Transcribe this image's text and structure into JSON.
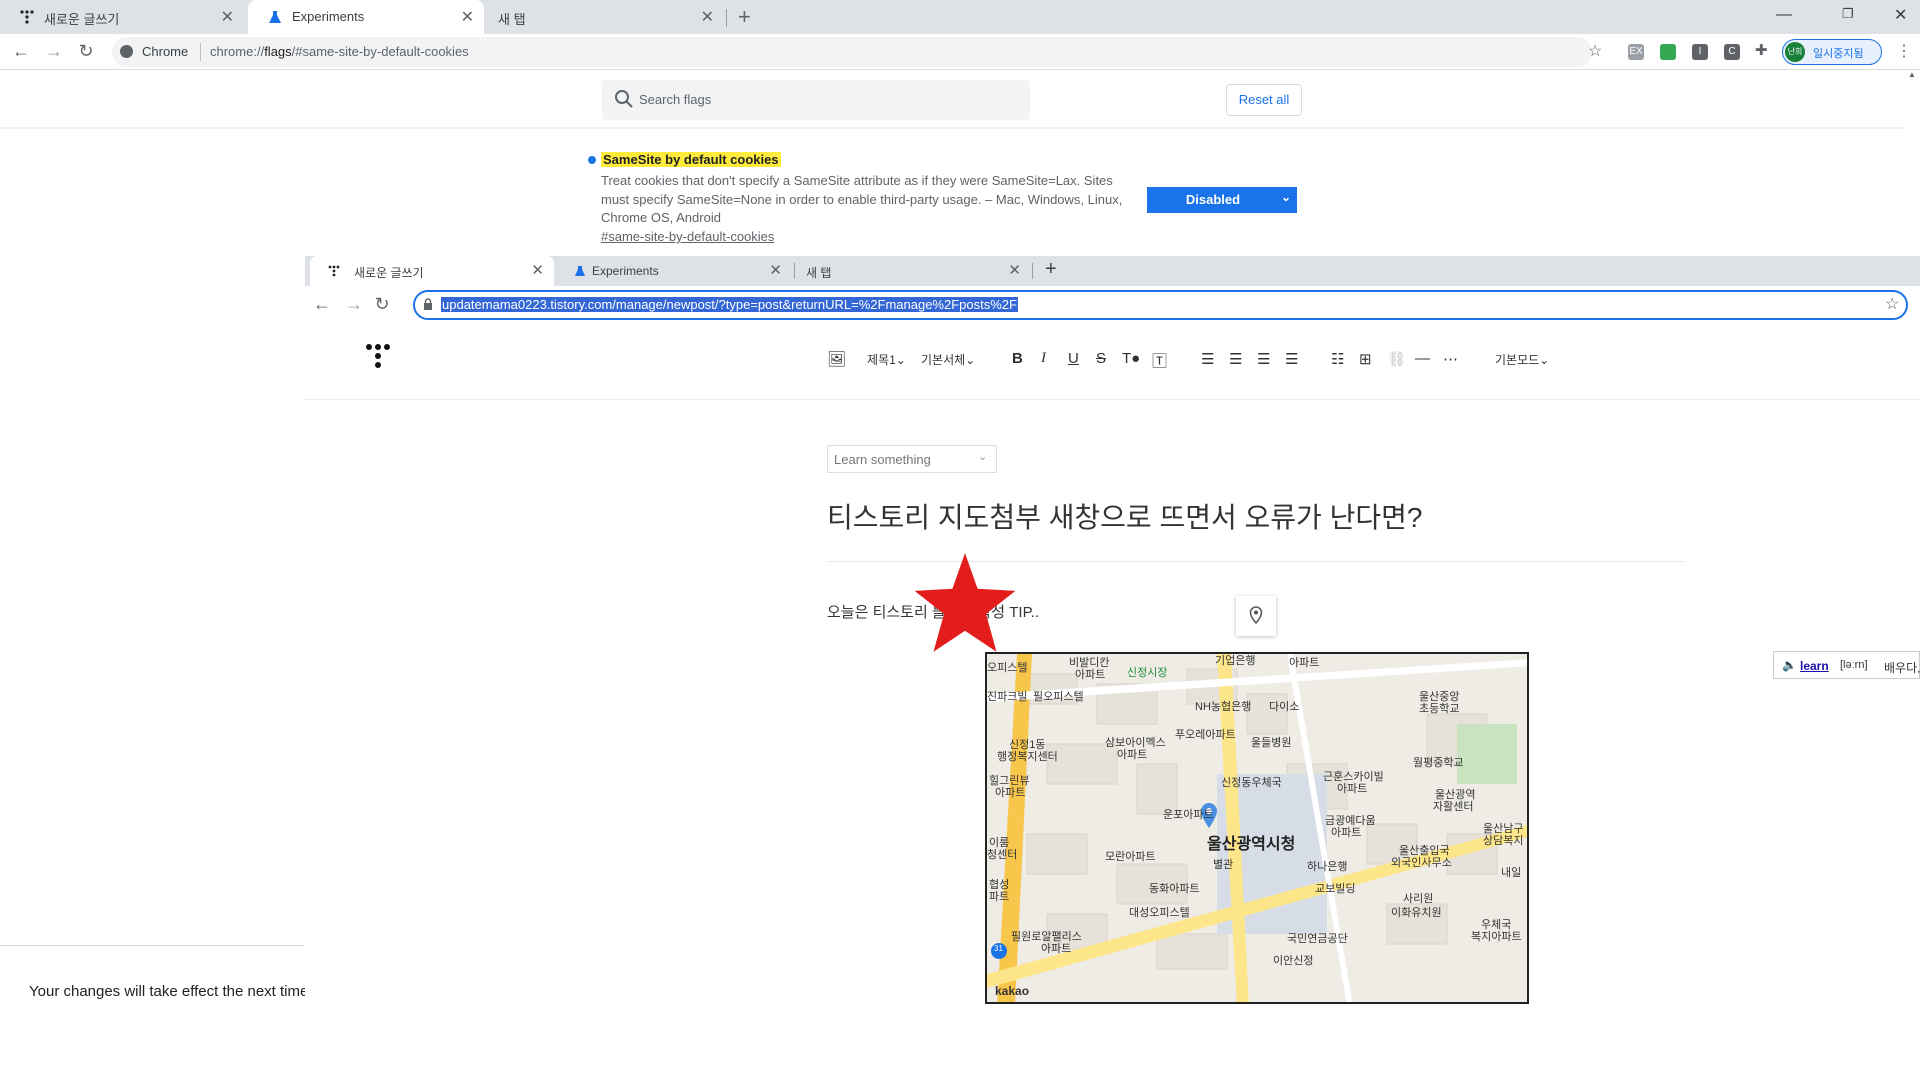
{
  "outer": {
    "tabs": [
      {
        "label": "새로운 글쓰기",
        "icon": "tistory-icon",
        "active": false
      },
      {
        "label": "Experiments",
        "icon": "flask-icon",
        "active": true
      },
      {
        "label": "새 탭",
        "icon": "",
        "active": false
      }
    ],
    "new_tab_label": "+",
    "omnibox": {
      "site_label": "Chrome",
      "url_prefix": "chrome://",
      "url_host": "flags",
      "url_rest": "/#same-site-by-default-cookies"
    },
    "profile_label": "일시중지됨",
    "profile_avatar": "난희",
    "extensions": [
      "ex-icon",
      "clipboard-icon",
      "i-icon",
      "c-icon",
      "puzzle-icon"
    ]
  },
  "flags": {
    "search_placeholder": "Search flags",
    "reset_label": "Reset all",
    "flag_title": "SameSite by default cookies",
    "flag_description": "Treat cookies that don't specify a SameSite attribute as if they were SameSite=Lax. Sites must specify SameSite=None in order to enable third-party usage. – Mac, Windows, Linux, Chrome OS, Android",
    "flag_link": "#same-site-by-default-cookies",
    "flag_value": "Disabled",
    "footer_message": "Your changes will take effect the next time you relaunch"
  },
  "inner": {
    "tabs": [
      {
        "label": "새로운 글쓰기",
        "active": true
      },
      {
        "label": "Experiments",
        "active": false
      },
      {
        "label": "새 탭",
        "active": false
      }
    ],
    "url": "updatemama0223.tistory.com/manage/newpost/?type=post&returnURL=%2Fmanage%2Fposts%2F"
  },
  "editor": {
    "heading_select": "제목1",
    "font_select": "기본서체",
    "mode_select": "기본모드",
    "category": "Learn something",
    "title": "티스토리 지도첨부 새창으로 뜨면서 오류가 난다면?",
    "body": "오늘은 티스토리 블로그 작성 TIP..",
    "map": {
      "center_label": "울산광역시청",
      "labels": [
        "오피스텔",
        "비발디칸",
        "아파트",
        "신정시장",
        "기업은행",
        "아파트",
        "진파크빌",
        "필오피스텔",
        "NH농협은행",
        "다이소",
        "울산중앙",
        "초등학교",
        "신정1동",
        "행정복지센터",
        "삼보아이멕스",
        "아파트",
        "푸오레아파트",
        "울들병원",
        "월평중학교",
        "신정동우체국",
        "근훈스카이빌",
        "아파트",
        "울산광역",
        "자활센터",
        "힐그린뷰",
        "아파트",
        "운포아파트",
        "금광예다움",
        "아파트",
        "울산남구",
        "상담복지",
        "이룸",
        "청센터",
        "모란아파트",
        "별관",
        "하나은행",
        "울산출입국",
        "외국인사무소",
        "내일",
        "협성",
        "파트",
        "동화아파트",
        "교보빌딩",
        "사리원",
        "이화유치원",
        "대성오피스텔",
        "필원로알팰리스",
        "아파트",
        "국민연금공단",
        "우체국",
        "복지아파트",
        "이안신정",
        "kakao",
        "31"
      ]
    }
  },
  "dictionary_popup": {
    "word": "learn",
    "phonetic": "[ləːrn]",
    "meaning": "배우다,"
  },
  "colors": {
    "accent": "#1a73e8",
    "highlight": "#ffeb3b",
    "star": "#e31c1c"
  }
}
